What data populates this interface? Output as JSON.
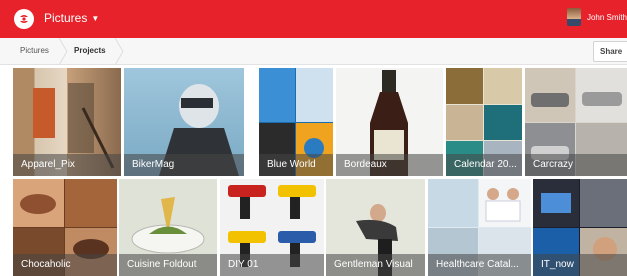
{
  "app": {
    "title": "Pictures"
  },
  "user": {
    "name": "John Smith"
  },
  "breadcrumb": {
    "root": "Pictures",
    "current": "Projects"
  },
  "toolbar": {
    "share_label": "Share"
  },
  "colors": {
    "brand": "#e8222a"
  },
  "tiles": [
    {
      "label": "Apparel_Pix"
    },
    {
      "label": "BikerMag"
    },
    {
      "label": "Blue World"
    },
    {
      "label": "Bordeaux"
    },
    {
      "label": "Calendar 20..."
    },
    {
      "label": "Carcrazy"
    },
    {
      "label": "Chocaholic"
    },
    {
      "label": "Cuisine Foldout"
    },
    {
      "label": "DIY 01"
    },
    {
      "label": "Gentleman Visual"
    },
    {
      "label": "Healthcare Catal..."
    },
    {
      "label": "IT_now"
    }
  ]
}
